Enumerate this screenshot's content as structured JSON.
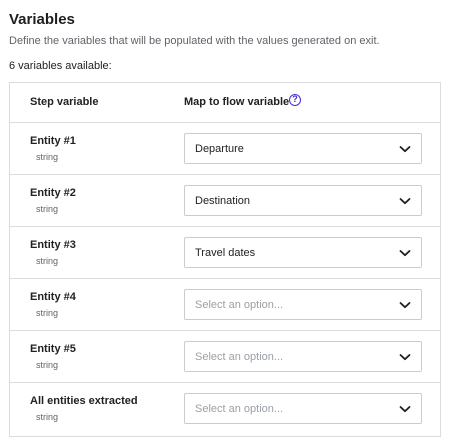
{
  "header": {
    "title": "Variables",
    "subtitle": "Define the variables that will be populated with the values generated on exit.",
    "count_text": "6 variables available:"
  },
  "table": {
    "columns": [
      "Step variable",
      "Map to flow variable"
    ],
    "help_icon": "question-circle-icon",
    "rows": [
      {
        "name": "Entity #1",
        "type": "string",
        "value": "Departure",
        "placeholder": ""
      },
      {
        "name": "Entity #2",
        "type": "string",
        "value": "Destination",
        "placeholder": ""
      },
      {
        "name": "Entity #3",
        "type": "string",
        "value": "Travel dates",
        "placeholder": ""
      },
      {
        "name": "Entity #4",
        "type": "string",
        "value": "",
        "placeholder": "Select an option..."
      },
      {
        "name": "Entity #5",
        "type": "string",
        "value": "",
        "placeholder": "Select an option..."
      },
      {
        "name": "All entities extracted",
        "type": "string",
        "value": "",
        "placeholder": "Select an option..."
      }
    ]
  },
  "colors": {
    "accent": "#4a2bd4",
    "border": "#dadce0",
    "placeholder": "#9aa0a6"
  }
}
